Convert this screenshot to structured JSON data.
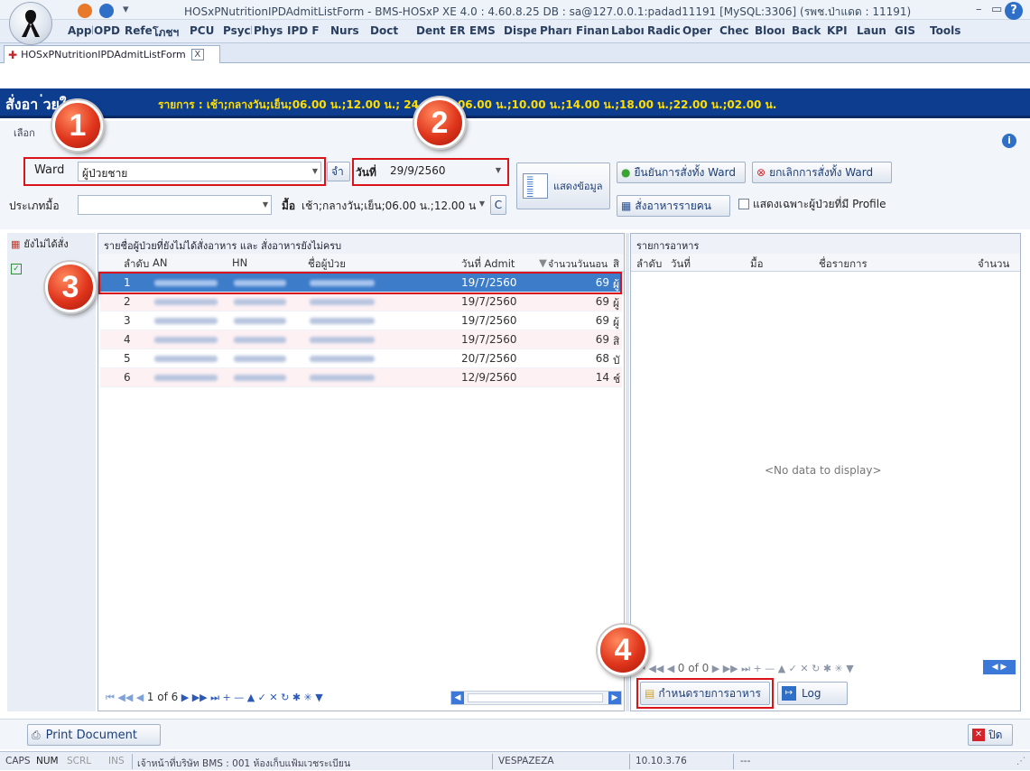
{
  "window": {
    "title": "HOSxPNutritionIPDAdmitListForm - BMS-HOSxP XE 4.0 : 4.60.8.25 DB : sa@127.0.0.1:padad11191 [MySQL:3306] (รพช.ป่าแดด : 11191)"
  },
  "menu": [
    "Appli",
    "OPD",
    "Refe",
    "โภชฯ",
    "PCU",
    "Psycl",
    "Physi",
    "IPD F",
    "Nurs",
    "Doct",
    "Dent",
    "ER",
    "EMS",
    "Dispe",
    "Pharı",
    "Finan",
    "Laboı",
    "Radic",
    "Oper",
    "Chec",
    "Blooı",
    "Back",
    "KPI",
    "Laun",
    "GIS",
    "Tools"
  ],
  "doc_tab": {
    "label": "HOSxPNutritionIPDAdmitListForm",
    "close": "X"
  },
  "header": {
    "title": "สั่งอาหารผู้ป่วยใน",
    "title_visible": "สั่งอา      ่วยใน",
    "info": "รายการ : เช้า;กลางวัน;เย็น;06.00 น.;12.00 น.;           24.00 น.;06.00 น.;10.00 น.;14.00 น.;18.00 น.;22.00 น.;02.00 น."
  },
  "options_label": "เลือก",
  "controls": {
    "ward_label": "Ward",
    "ward_value": "ผู้ป่วยชาย",
    "remember": "จำ",
    "date_label": "วันที่",
    "date_value": "29/9/2560",
    "show_data": "แสดงข้อมูล",
    "confirm_ward": "ยืนยันการสั่งทั้ง Ward",
    "cancel_ward": "ยกเลิกการสั่งทั้ง Ward",
    "order_per_patient": "สั่งอาหารรายคน",
    "profile_only": "แสดงเฉพาะผู้ป่วยที่มี Profile",
    "meal_type_label": "ประเภทมื้อ",
    "meal_type_value": "",
    "meal_label": "มื้อ",
    "meal_value": "เช้า;กลางวัน;เย็น;06.00 น.;12.00 น",
    "clear": "C"
  },
  "sidebar": {
    "items": [
      "ยังไม่ได้สั่ง",
      ""
    ]
  },
  "patients": {
    "title": "รายชื่อผู้ป่วยที่ยังไม่ได้สั่งอาหาร และ สั่งอาหารยังไม่ครบ",
    "columns": [
      "ลำดับ",
      "AN",
      "HN",
      "ชื่อผู้ป่วย",
      "วันที่ Admit",
      "จำนวนวันนอน",
      "สิ"
    ],
    "rows": [
      {
        "no": "1",
        "admit": "19/7/2560",
        "days": "69",
        "extra": "ผู้"
      },
      {
        "no": "2",
        "admit": "19/7/2560",
        "days": "69",
        "extra": "ผู้"
      },
      {
        "no": "3",
        "admit": "19/7/2560",
        "days": "69",
        "extra": "ผู้"
      },
      {
        "no": "4",
        "admit": "19/7/2560",
        "days": "69",
        "extra": "สิ"
      },
      {
        "no": "5",
        "admit": "20/7/2560",
        "days": "68",
        "extra": "บั"
      },
      {
        "no": "6",
        "admit": "12/9/2560",
        "days": "14",
        "extra": "ช์"
      }
    ],
    "pager": "1 of 6"
  },
  "food": {
    "title": "รายการอาหาร",
    "columns": [
      "ลำดับ",
      "วันที่",
      "มื้อ",
      "ชื่อรายการ",
      "จำนวน"
    ],
    "empty": "<No data to display>",
    "pager": "0 of 0",
    "define_button": "กำหนดรายการอาหาร",
    "log_button": "Log"
  },
  "footer": {
    "print": "Print Document",
    "close": "ปิด"
  },
  "status": {
    "caps": "CAPS",
    "num": "NUM",
    "scrl": "SCRL",
    "ins": "INS",
    "user": "เจ้าหน้าที่บริษัท BMS : 001 ห้องเก็บแฟ้มเวชระเบียน",
    "host": "VESPAZEZA",
    "ip": "10.10.3.76",
    "extra": "---"
  },
  "callouts": [
    "1",
    "2",
    "3",
    "4"
  ],
  "colors": {
    "header_bg": "#0d3d8f",
    "header_info": "#ffde00",
    "highlight_row": "#3d7cc9",
    "callout": "#e0351c",
    "box": "#d9141b"
  }
}
